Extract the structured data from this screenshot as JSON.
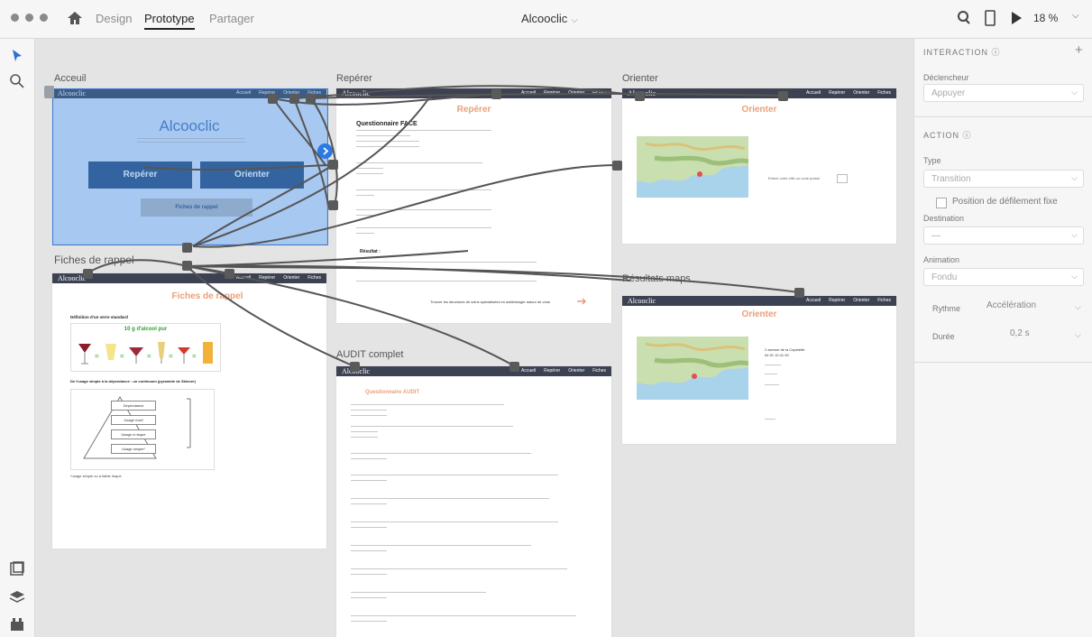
{
  "app": {
    "tabs": [
      {
        "label": "Design",
        "active": false
      },
      {
        "label": "Prototype",
        "active": true
      },
      {
        "label": "Partager",
        "active": false
      }
    ],
    "document_title": "Alcooclic",
    "zoom": "18 %"
  },
  "left_toolbar": {
    "tools": [
      "select-tool-icon",
      "zoom-tool-icon"
    ],
    "bottom": [
      "document-assets-icon",
      "layers-icon",
      "plugins-icon"
    ]
  },
  "artboards": {
    "accueil": {
      "label": "Acceuil",
      "brand": "Alcooclic",
      "nav": [
        "Accueil",
        "Repérer",
        "Orienter",
        "Fiches"
      ],
      "btn_reperer": "Repérer",
      "btn_orienter": "Orienter",
      "btn_fiches": "Fiches de rappel"
    },
    "reperer": {
      "label": "Repérer",
      "brand": "Alcooclic",
      "nav": [
        "Accueil",
        "Repérer",
        "Orienter",
        "Fiches"
      ],
      "title": "Repérer",
      "questionnaire": "Questionnaire FACE",
      "resultat": "Résultat :",
      "link_text": "Trouver les structures de soins spécialisées en addictologie autour de vous"
    },
    "orienter": {
      "label": "Orienter",
      "brand": "Alcooclic",
      "nav": [
        "Accueil",
        "Repérer",
        "Orienter",
        "Fiches"
      ],
      "title": "Orienter",
      "search_text": "Entrez votre ville ou code postal"
    },
    "fiches": {
      "label": "Fiches de rappel",
      "brand": "Alcooclic",
      "nav": [
        "Accueil",
        "Repérer",
        "Orienter",
        "Fiches"
      ],
      "title": "Fiches de rappel",
      "section1": "Définition d'un verre standard",
      "alcool": "10 g d'alcool pur",
      "section2": "De l'usage simple à la dépendance : un continuum (pyramide de Skinner)",
      "pyramid": [
        "Dépendance",
        "Usage nocif",
        "Usage à risque",
        "Usage simple*"
      ],
      "note": "*usage simple ou à faible risque"
    },
    "audit": {
      "label": "AUDIT complet",
      "brand": "Alcooclic",
      "nav": [
        "Accueil",
        "Repérer",
        "Orienter",
        "Fiches"
      ],
      "title": "Questionnaire AUDIT"
    },
    "resultats": {
      "label": "Résultats maps",
      "brand": "Alcooclic",
      "nav": [
        "Accueil",
        "Repérer",
        "Orienter",
        "Fiches"
      ],
      "title": "Orienter",
      "address": "2 avenue de la Capelette",
      "phone": "04 91 10 41 00"
    }
  },
  "right_panel": {
    "interaction_header": "INTERACTION",
    "trigger_label": "Déclencheur",
    "trigger_value": "Appuyer",
    "action_header": "ACTION",
    "type_label": "Type",
    "type_value": "Transition",
    "scroll_label": "Position de défilement fixe",
    "destination_label": "Destination",
    "destination_value": "—",
    "animation_label": "Animation",
    "animation_value": "Fondu",
    "rhythm_label": "Rythme",
    "rhythm_value": "Accélération",
    "duration_label": "Durée",
    "duration_value": "0,2 s"
  },
  "colors": {
    "accent_blue": "#3a7bd5",
    "nav_dark": "#3c4252",
    "button_navy": "#2f4f7a",
    "title_peach": "#e8a07a",
    "connector": "#555555"
  }
}
